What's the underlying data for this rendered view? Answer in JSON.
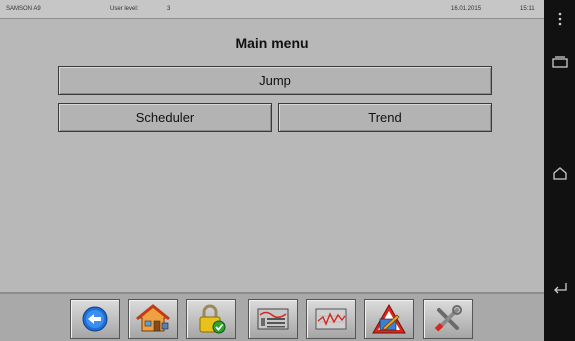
{
  "statusbar": {
    "device": "SAMSON A9",
    "user_level_label": "User level:",
    "user_level_value": "3",
    "date": "16.01.2015",
    "time": "15:11"
  },
  "main": {
    "title": "Main menu",
    "buttons": {
      "jump": "Jump",
      "scheduler": "Scheduler",
      "trend": "Trend"
    }
  },
  "toolbar": {
    "icons": [
      "back-arrow-icon",
      "home-icon",
      "lock-check-icon",
      "device-display-icon",
      "trend-graph-icon",
      "warning-alarm-icon",
      "settings-tools-icon"
    ]
  },
  "android_nav": {
    "icons": [
      "overflow-menu-icon",
      "recent-apps-icon",
      "home-icon",
      "back-icon"
    ]
  },
  "colors": {
    "background": "#b8b8b8",
    "toolbar": "#a9a9a9",
    "back_blue": "#1f6fd6",
    "house_orange": "#e07a1f",
    "lock_yellow": "#e8c21a",
    "check_green": "#2fa52f",
    "alarm_red": "#d4291e"
  }
}
